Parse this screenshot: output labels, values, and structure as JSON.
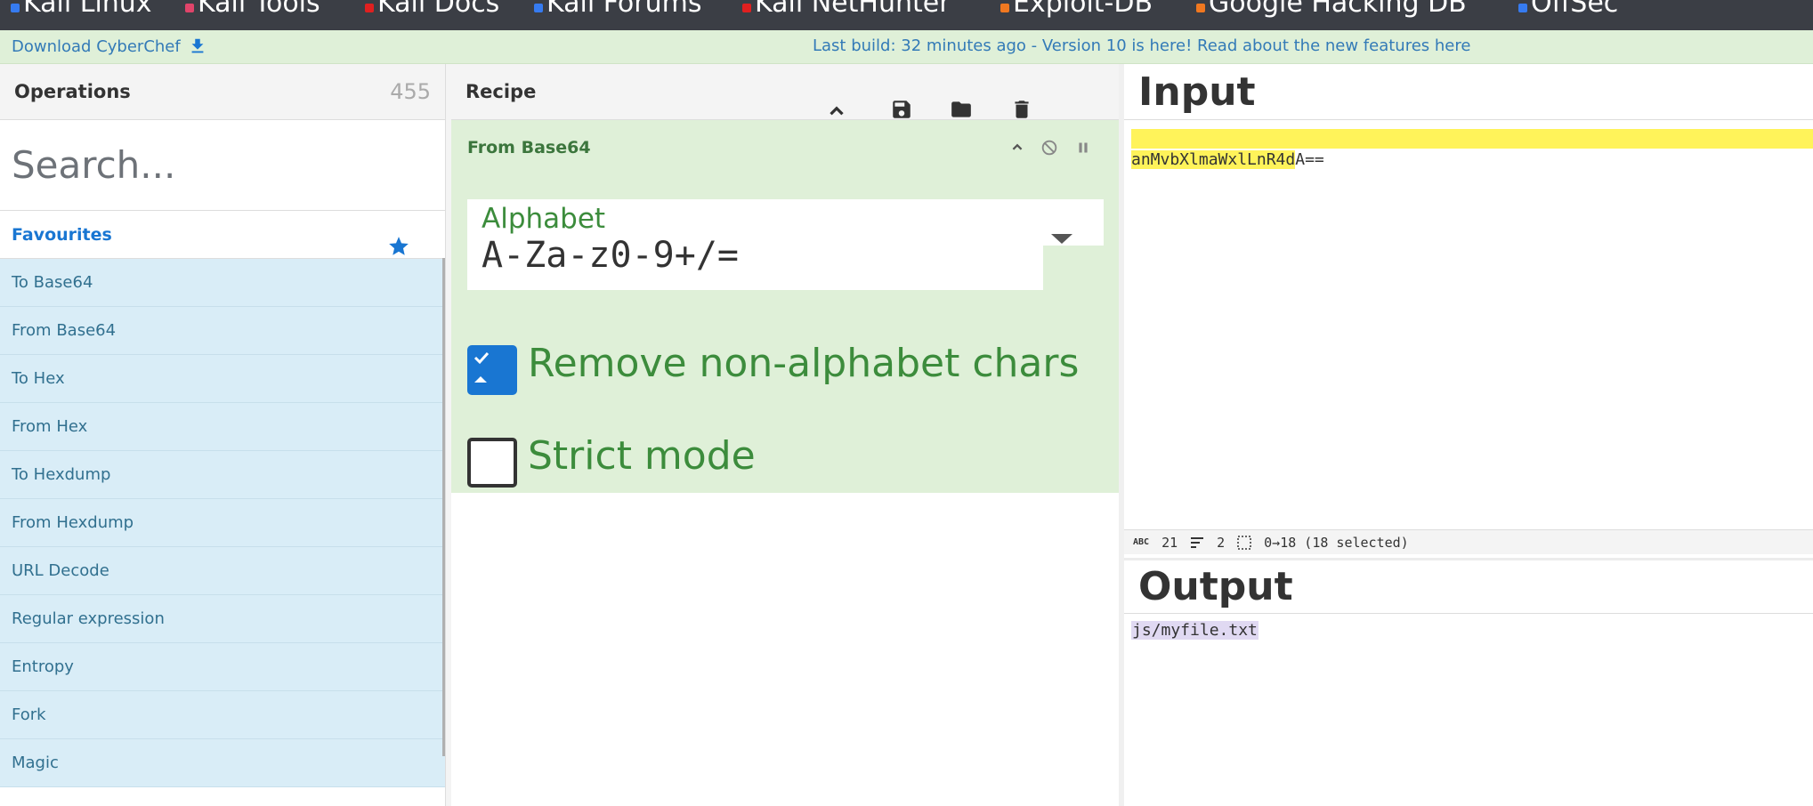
{
  "bookmarks": [
    {
      "label": "Kali Linux",
      "color": "#367bf0"
    },
    {
      "label": "Kali Tools",
      "color": "#e0446a"
    },
    {
      "label": "Kali Docs",
      "color": "#e02020"
    },
    {
      "label": "Kali Forums",
      "color": "#367bf0"
    },
    {
      "label": "Kali NetHunter",
      "color": "#e02020"
    },
    {
      "label": "Exploit-DB",
      "color": "#f07820"
    },
    {
      "label": "Google Hacking DB",
      "color": "#f07820"
    },
    {
      "label": "OffSec",
      "color": "#367bf0"
    }
  ],
  "banner": {
    "download_label": "Download CyberChef",
    "build_text": "Last build: 32 minutes ago - Version 10 is here! Read about the new features here"
  },
  "operations": {
    "title": "Operations",
    "count": "455",
    "search_placeholder": "Search...",
    "favourites_label": "Favourites",
    "items": [
      "To Base64",
      "From Base64",
      "To Hex",
      "From Hex",
      "To Hexdump",
      "From Hexdump",
      "URL Decode",
      "Regular expression",
      "Entropy",
      "Fork",
      "Magic"
    ]
  },
  "recipe": {
    "title": "Recipe",
    "operation": {
      "name": "From Base64",
      "alphabet_label": "Alphabet",
      "alphabet_value": "A-Za-z0-9+/=",
      "remove_non_alpha_label": "Remove non-alphabet chars",
      "remove_non_alpha_checked": true,
      "strict_mode_label": "Strict mode",
      "strict_mode_checked": false
    }
  },
  "input": {
    "title": "Input",
    "text_selected": "anMvbXlmaWxlLnR4d",
    "text_rest": "A==",
    "status": {
      "length": "21",
      "lines": "2",
      "selection": "0→18 (18 selected)"
    }
  },
  "output": {
    "title": "Output",
    "text": "js/myfile.txt"
  },
  "colors": {
    "banner_bg": "#dff0d8",
    "op_item_bg": "#d9edf7",
    "recipe_card_bg": "#dff0d8",
    "accent": "#1976d2",
    "highlight": "#fff35a"
  }
}
